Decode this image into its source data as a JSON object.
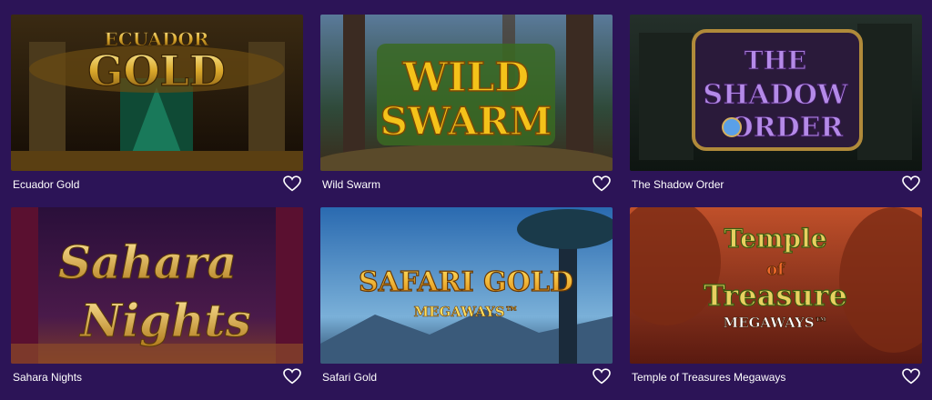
{
  "colors": {
    "background": "#2c1457",
    "caption_text": "#ffffff",
    "heart_outline": "#ffffff"
  },
  "games": [
    {
      "name": "Ecuador Gold",
      "logo_lines": [
        "ECUADOR",
        "GOLD"
      ],
      "favorite_icon": "heart-outline-icon"
    },
    {
      "name": "Wild Swarm",
      "logo_lines": [
        "WILD",
        "SWARM"
      ],
      "favorite_icon": "heart-outline-icon"
    },
    {
      "name": "The Shadow Order",
      "logo_lines": [
        "THE",
        "SHADOW",
        "ORDER"
      ],
      "favorite_icon": "heart-outline-icon"
    },
    {
      "name": "Sahara Nights",
      "logo_lines": [
        "Sahara",
        "Nights"
      ],
      "favorite_icon": "heart-outline-icon"
    },
    {
      "name": "Safari Gold",
      "logo_lines": [
        "SAFARI GOLD",
        "MEGAWAYS™"
      ],
      "favorite_icon": "heart-outline-icon"
    },
    {
      "name": "Temple of Treasures Megaways",
      "logo_lines": [
        "Temple",
        "of",
        "Treasure",
        "MEGAWAYS™"
      ],
      "favorite_icon": "heart-outline-icon"
    }
  ]
}
